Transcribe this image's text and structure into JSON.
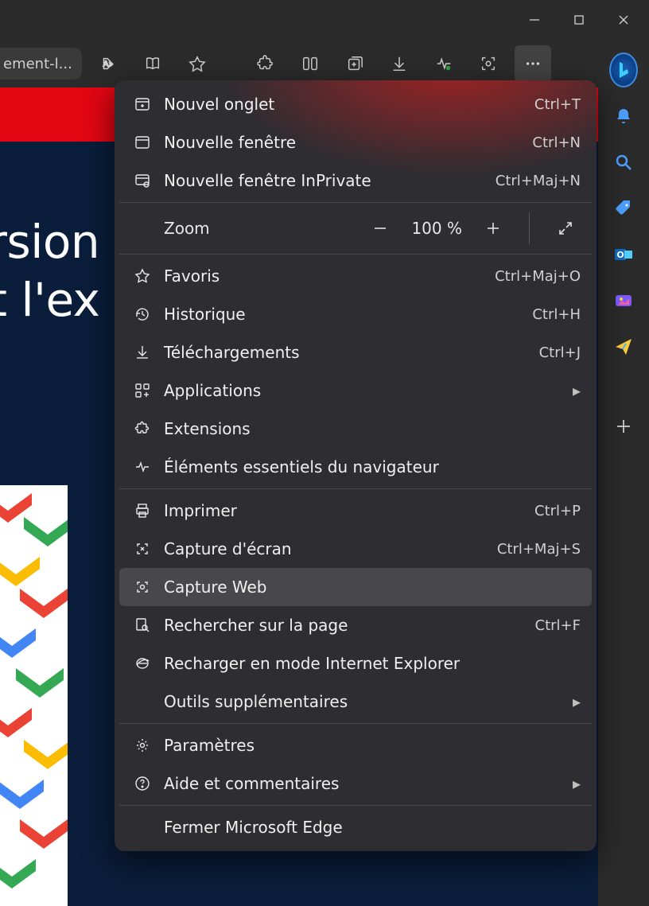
{
  "titlebar": {},
  "toolbar": {
    "tab_fragment": "ement-l..."
  },
  "page": {
    "headline_line1": "ersion",
    "headline_line2": "nt l'ex"
  },
  "menu": {
    "new_tab": {
      "label": "Nouvel onglet",
      "shortcut": "Ctrl+T"
    },
    "new_window": {
      "label": "Nouvelle fenêtre",
      "shortcut": "Ctrl+N"
    },
    "new_inprivate": {
      "label": "Nouvelle fenêtre InPrivate",
      "shortcut": "Ctrl+Maj+N"
    },
    "zoom": {
      "label": "Zoom",
      "value": "100 %"
    },
    "favorites": {
      "label": "Favoris",
      "shortcut": "Ctrl+Maj+O"
    },
    "history": {
      "label": "Historique",
      "shortcut": "Ctrl+H"
    },
    "downloads": {
      "label": "Téléchargements",
      "shortcut": "Ctrl+J"
    },
    "apps": {
      "label": "Applications"
    },
    "extensions": {
      "label": "Extensions"
    },
    "essentials": {
      "label": "Éléments essentiels du navigateur"
    },
    "print": {
      "label": "Imprimer",
      "shortcut": "Ctrl+P"
    },
    "screenshot": {
      "label": "Capture d'écran",
      "shortcut": "Ctrl+Maj+S"
    },
    "webcapture": {
      "label": "Capture Web"
    },
    "find": {
      "label": "Rechercher sur la page",
      "shortcut": "Ctrl+F"
    },
    "ie_mode": {
      "label": "Recharger en mode Internet Explorer"
    },
    "more_tools": {
      "label": "Outils supplémentaires"
    },
    "settings": {
      "label": "Paramètres"
    },
    "help": {
      "label": "Aide et commentaires"
    },
    "close": {
      "label": "Fermer Microsoft Edge"
    }
  }
}
